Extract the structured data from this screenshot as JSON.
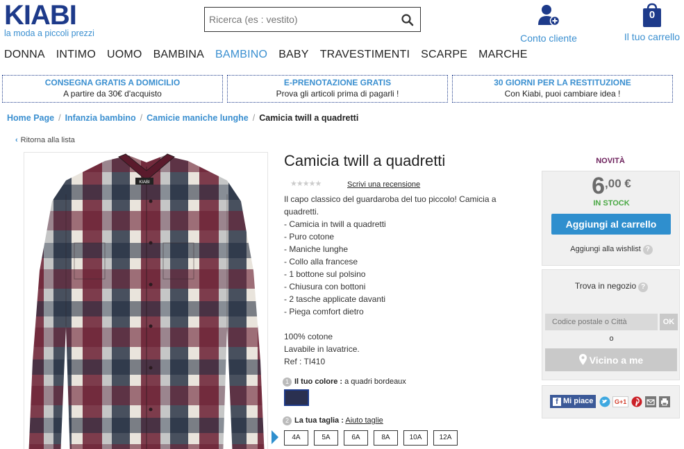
{
  "header": {
    "logo_text": "KIABI",
    "tagline": "la moda a piccoli prezzi",
    "search_placeholder": "Ricerca (es : vestito)",
    "account_label": "Conto cliente",
    "cart_label": "Il tuo carrello",
    "cart_count": "0"
  },
  "nav": {
    "items": [
      "DONNA",
      "INTIMO",
      "UOMO",
      "BAMBINA",
      "BAMBINO",
      "BABY",
      "TRAVESTIMENTI",
      "SCARPE",
      "MARCHE"
    ],
    "active": "BAMBINO"
  },
  "banners": [
    {
      "title": "CONSEGNA GRATIS A DOMICILIO",
      "sub": "A partire da 30€ d'acquisto"
    },
    {
      "title": "E-PRENOTAZIONE GRATIS",
      "sub": "Prova gli articoli prima di pagarli !"
    },
    {
      "title": "30 GIORNI PER LA RESTITUZIONE",
      "sub": "Con Kiabi, puoi cambiare idea !"
    }
  ],
  "breadcrumb": [
    "Home Page",
    "Infanzia bambino",
    "Camicie maniche lunghe",
    "Camicia twill a quadretti"
  ],
  "back_label": "Ritorna alla lista",
  "product": {
    "title": "Camicia twill a quadretti",
    "stars": "★★★★★",
    "review_link": "Scrivi una recensione",
    "description": [
      "Il capo classico del guardaroba del tuo piccolo! Camicia a",
      "quadretti.",
      "- Camicia in twill a quadretti",
      "- Puro cotone",
      "- Maniche lunghe",
      "- Collo alla francese",
      "- 1 bottone sul polsino",
      "- Chiusura con bottoni",
      "- 2 tasche applicate davanti",
      "- Piega comfort dietro",
      "",
      "100% cotone",
      "Lavabile in lavatrice.",
      "Ref : TI410"
    ],
    "color_step": "1",
    "color_label": "Il tuo colore :",
    "color_value": "a quadri bordeaux",
    "size_step": "2",
    "size_label": "La tua taglia :",
    "size_help": "Aiuto taglie",
    "sizes": [
      "4A",
      "5A",
      "6A",
      "8A",
      "10A",
      "12A"
    ],
    "photo_brand_label": "KIABI"
  },
  "buybox": {
    "badge": "NOVITÀ",
    "price_int": "6",
    "price_dec": ",00 €",
    "stock": "IN STOCK",
    "add_to_cart": "Aggiungi al carrello",
    "wishlist": "Aggiungi alla wishlist",
    "help": "?"
  },
  "store": {
    "title": "Trova in negozio",
    "zip_placeholder": "Codice postale o Città",
    "ok": "OK",
    "or": "o",
    "near_me": "Vicino a me"
  },
  "share": {
    "facebook": "Mi piace",
    "fb_glyph": "f",
    "gplus": "G+1"
  },
  "colors": {
    "brand_blue": "#1d3a8a",
    "accent_blue": "#3a8fd0",
    "button_blue": "#2f8fce",
    "stock_green": "#49a843",
    "badge_purple": "#6b1e5a"
  }
}
